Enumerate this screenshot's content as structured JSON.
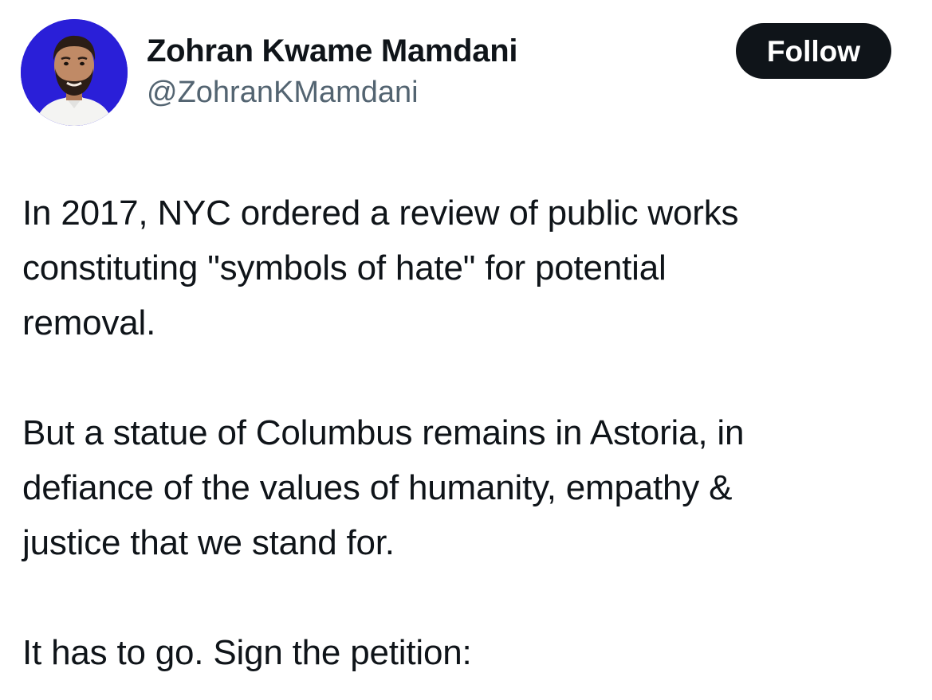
{
  "author": {
    "display_name": "Zohran Kwame Mamdani",
    "handle": "@ZohranKMamdani",
    "avatar_icon": "profile-photo",
    "avatar_background": "#2a1fd8"
  },
  "actions": {
    "follow_label": "Follow",
    "follow_button_color": "#0f1419"
  },
  "tweet": {
    "paragraphs": [
      {
        "lines": [
          "In 2017, NYC ordered a review of public works",
          "constituting \"symbols of hate\" for potential",
          "removal."
        ]
      },
      {
        "lines": [
          "But a statue of Columbus remains in Astoria, in",
          "defiance of the values of humanity, empathy &",
          "justice that we stand for."
        ]
      },
      {
        "lines": [
          "It has to go. Sign the petition:"
        ]
      }
    ]
  },
  "colors": {
    "text_primary": "#0f1419",
    "text_secondary": "#536471",
    "background": "#ffffff"
  }
}
